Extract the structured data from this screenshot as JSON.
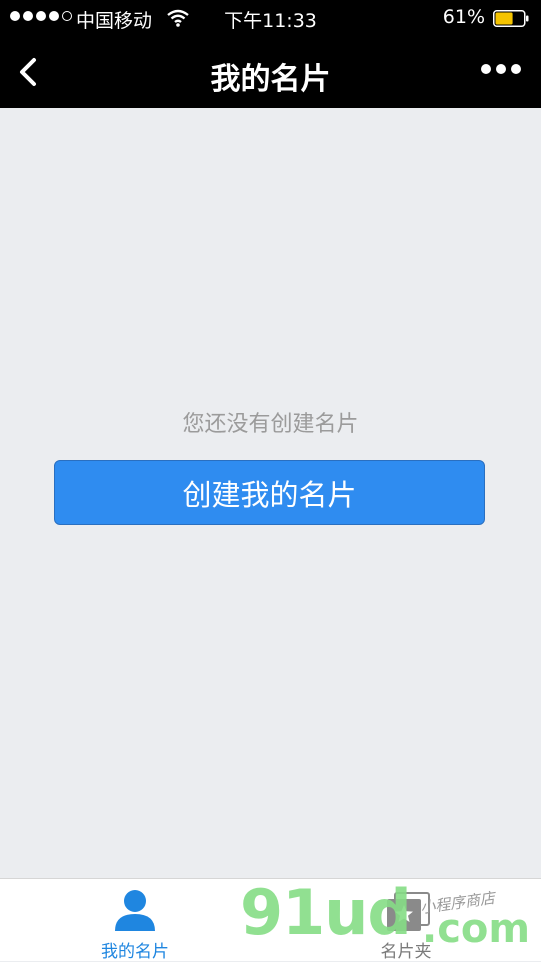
{
  "status_bar": {
    "carrier": "中国移动",
    "time": "下午11:33",
    "battery_percent": "61%",
    "battery_level": 0.61,
    "signal_bars_filled": 4,
    "signal_bars_total": 5
  },
  "nav": {
    "title": "我的名片",
    "back_icon": "chevron-left-icon",
    "more_icon": "more-dots-icon"
  },
  "main": {
    "empty_message": "您还没有创建名片",
    "create_button_label": "创建我的名片"
  },
  "tabbar": {
    "items": [
      {
        "label": "我的名片",
        "icon": "person-icon",
        "active": true
      },
      {
        "label": "名片夹",
        "icon": "star-card-icon",
        "active": false
      }
    ]
  },
  "watermark": {
    "brand": "91ud",
    "domain": ".com",
    "tagline": "小程序商店"
  },
  "colors": {
    "header_bg": "#000000",
    "page_bg": "#ebedf0",
    "accent_blue": "#2f8cf0",
    "tab_active": "#1f86e0",
    "battery_fill": "#f5c400",
    "watermark_green": "#86dd86"
  }
}
